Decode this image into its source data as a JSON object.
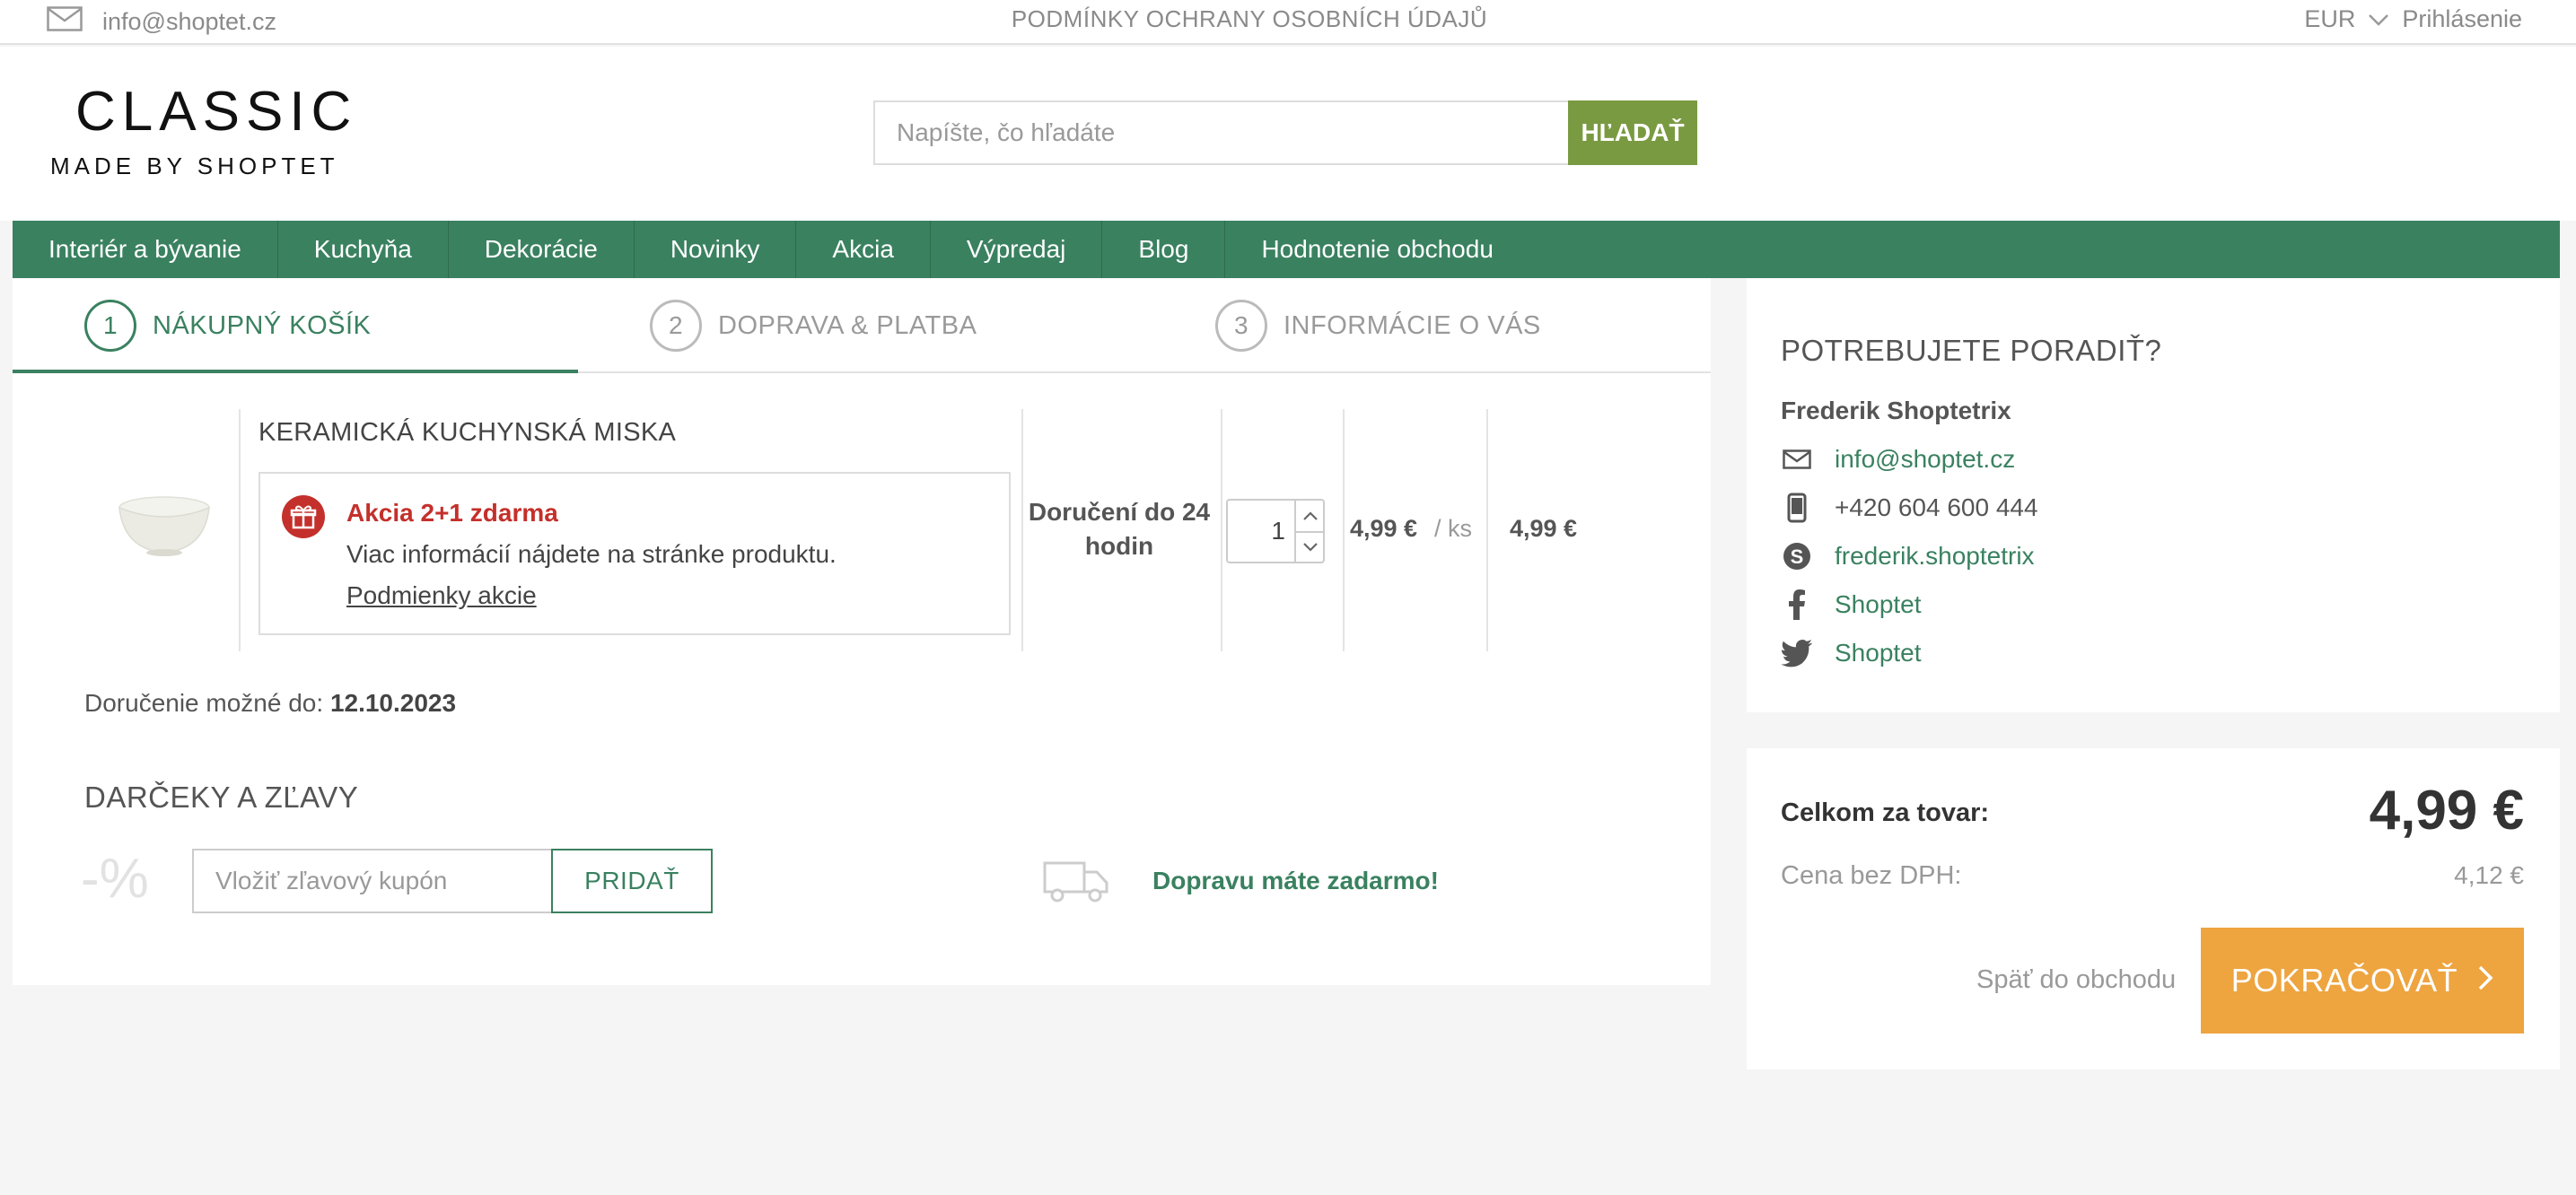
{
  "topbar": {
    "email": "info@shoptet.cz",
    "privacy": "PODMÍNKY OCHRANY OSOBNÍCH ÚDAJŮ",
    "currency": "EUR",
    "login": "Prihlásenie"
  },
  "header": {
    "logo_line1": "CLASSIC",
    "logo_line2": "MADE BY SHOPTET",
    "search_placeholder": "Napíšte, čo hľadáte",
    "search_button": "HĽADAŤ"
  },
  "nav": {
    "items": [
      "Interiér a bývanie",
      "Kuchyňa",
      "Dekorácie",
      "Novinky",
      "Akcia",
      "Výpredaj",
      "Blog",
      "Hodnotenie obchodu"
    ]
  },
  "steps": [
    {
      "num": "1",
      "label": "NÁKUPNÝ KOŠÍK"
    },
    {
      "num": "2",
      "label": "DOPRAVA & PLATBA"
    },
    {
      "num": "3",
      "label": "INFORMÁCIE O VÁS"
    }
  ],
  "cart": {
    "product_name": "KERAMICKÁ KUCHYNSKÁ MISKA",
    "promo_title": "Akcia 2+1 zdarma",
    "promo_text": "Viac informácií nájdete na stránke produktu.",
    "promo_link": "Podmienky akcie",
    "delivery": "Doručení do 24 hodin",
    "quantity": "1",
    "unit_price": "4,99 €",
    "unit_label": "/ ks",
    "total_price": "4,99 €"
  },
  "delivery_date": {
    "label": "Doručenie možné do:",
    "value": "12.10.2023"
  },
  "discounts": {
    "title": "DARČEKY A ZĽAVY",
    "percent_symbol": "-%",
    "coupon_placeholder": "Vložiť zľavový kupón",
    "add_button": "PRIDAŤ",
    "free_shipping": "Dopravu máte zadarmo!"
  },
  "help": {
    "title": "POTREBUJETE PORADIŤ?",
    "name": "Frederik Shoptetrix",
    "email": "info@shoptet.cz",
    "phone": "+420 604 600 444",
    "skype": "frederik.shoptetrix",
    "facebook": "Shoptet",
    "twitter": "Shoptet"
  },
  "summary": {
    "total_label": "Celkom za tovar:",
    "total_value": "4,99 €",
    "net_label": "Cena bez DPH:",
    "net_value": "4,12 €",
    "back_link": "Späť do obchodu",
    "continue_button": "POKRAČOVAŤ"
  },
  "colors": {
    "brand_green": "#3a8160",
    "search_green": "#7a9a42",
    "promo_red": "#c4302b",
    "continue_orange": "#eea43f"
  }
}
